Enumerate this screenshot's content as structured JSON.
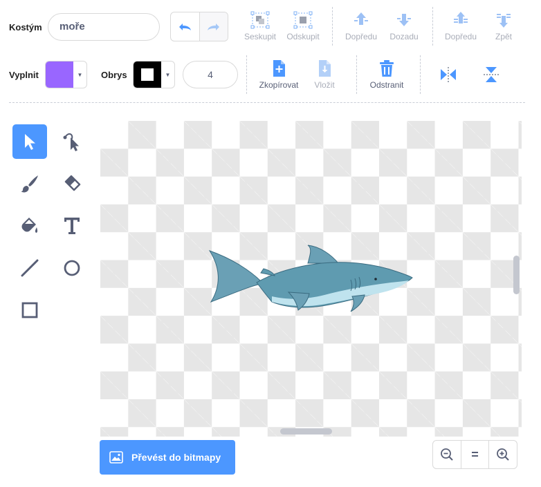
{
  "costume": {
    "label": "Kostým",
    "name_value": "moře"
  },
  "history": {
    "undo_icon": "undo-icon",
    "redo_icon": "redo-icon"
  },
  "arrange": {
    "group": "Seskupit",
    "ungroup": "Odskupit",
    "forward": "Dopředu",
    "backward": "Dozadu",
    "front": "Dopředu",
    "back": "Zpět"
  },
  "fill": {
    "label": "Vyplnit",
    "color": "#9966ff"
  },
  "outline": {
    "label": "Obrys",
    "color": "#000000",
    "size": "4"
  },
  "edit": {
    "copy": "Zkopírovat",
    "paste": "Vložit",
    "delete": "Odstranit"
  },
  "flip": {
    "horizontal_icon": "flip-horizontal-icon",
    "vertical_icon": "flip-vertical-icon"
  },
  "tools": [
    {
      "name": "select-tool",
      "icon": "select-arrow-icon",
      "selected": true
    },
    {
      "name": "reshape-tool",
      "icon": "reshape-icon"
    },
    {
      "name": "brush-tool",
      "icon": "brush-icon"
    },
    {
      "name": "eraser-tool",
      "icon": "eraser-icon"
    },
    {
      "name": "fill-tool",
      "icon": "paint-bucket-icon"
    },
    {
      "name": "text-tool",
      "icon": "text-t-icon",
      "glyph": "T"
    },
    {
      "name": "line-tool",
      "icon": "line-icon"
    },
    {
      "name": "circle-tool",
      "icon": "circle-icon"
    },
    {
      "name": "rectangle-tool",
      "icon": "rectangle-icon"
    }
  ],
  "canvas": {
    "content_icon": "shark-drawing"
  },
  "convert": {
    "label": "Převést do bitmapy"
  },
  "zoom": {
    "out_icon": "zoom-out-icon",
    "reset_label": "=",
    "in_icon": "zoom-in-icon"
  },
  "colors": {
    "accent": "#4c97ff",
    "text": "#575e75",
    "disabled": "#a9adb8"
  }
}
